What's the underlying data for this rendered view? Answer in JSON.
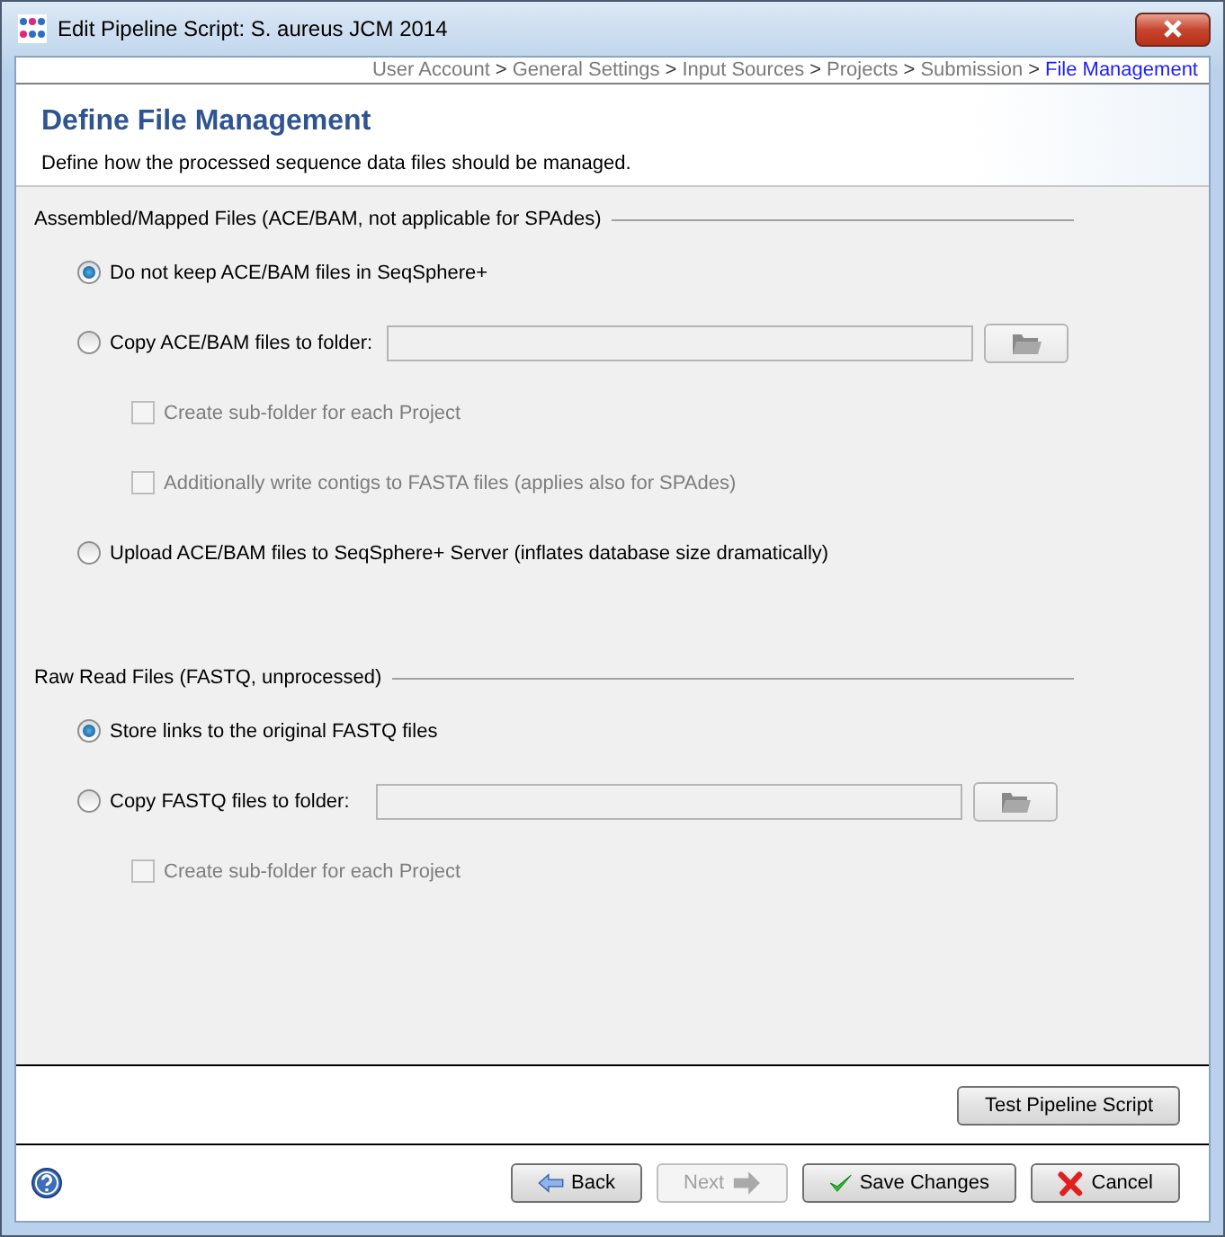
{
  "window": {
    "title": "Edit Pipeline Script: S. aureus JCM 2014"
  },
  "breadcrumb": {
    "separator": ">",
    "items": [
      {
        "label": "User Account",
        "selected": false
      },
      {
        "label": "General Settings",
        "selected": false
      },
      {
        "label": "Input Sources",
        "selected": false
      },
      {
        "label": "Projects",
        "selected": false
      },
      {
        "label": "Submission",
        "selected": false
      },
      {
        "label": "File Management",
        "selected": true
      }
    ]
  },
  "header": {
    "title": "Define File Management",
    "description": "Define how the processed sequence data files should be managed."
  },
  "sections": [
    {
      "title": "Assembled/Mapped Files (ACE/BAM, not applicable for SPAdes)",
      "options": [
        {
          "kind": "radio",
          "label": "Do not keep ACE/BAM files in SeqSphere+",
          "selected": true
        },
        {
          "kind": "radio",
          "label": "Copy ACE/BAM files to folder:",
          "selected": false,
          "folder_field": true
        },
        {
          "kind": "checkbox",
          "label": "Create sub-folder for each Project",
          "checked": false,
          "disabled": true
        },
        {
          "kind": "checkbox",
          "label": "Additionally write contigs to FASTA files (applies also for SPAdes)",
          "checked": false,
          "disabled": true
        },
        {
          "kind": "radio",
          "label": "Upload ACE/BAM files to SeqSphere+ Server (inflates database size dramatically)",
          "selected": false
        }
      ]
    },
    {
      "title": "Raw Read Files (FASTQ, unprocessed)",
      "options": [
        {
          "kind": "radio",
          "label": "Store links to the original FASTQ files",
          "selected": true
        },
        {
          "kind": "radio",
          "label": "Copy FASTQ files to folder:",
          "selected": false,
          "folder_field": true
        },
        {
          "kind": "checkbox",
          "label": "Create sub-folder for each Project",
          "checked": false,
          "disabled": true
        }
      ]
    }
  ],
  "test_button": {
    "label": "Test Pipeline Script"
  },
  "footer_buttons": [
    {
      "kind": "back",
      "label": "Back",
      "disabled": false
    },
    {
      "kind": "next",
      "label": "Next",
      "disabled": true
    },
    {
      "kind": "save",
      "label": "Save Changes",
      "disabled": false
    },
    {
      "kind": "cancel",
      "label": "Cancel",
      "disabled": false
    }
  ]
}
